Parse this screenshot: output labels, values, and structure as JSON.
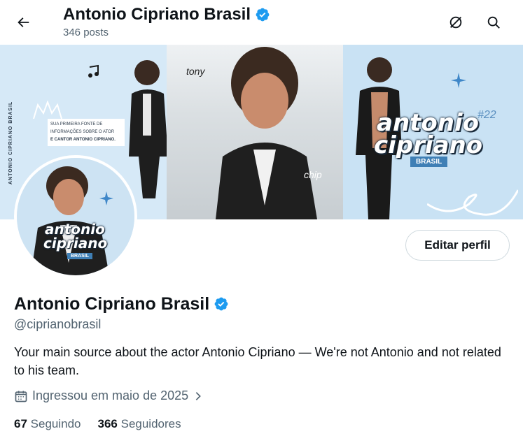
{
  "header": {
    "title": "Antonio Cipriano Brasil",
    "post_count": "346 posts"
  },
  "banner": {
    "tagline_1": "SUA PRIMEIRA FONTE DE",
    "tagline_2": "INFORMAÇÕES SOBRE O ATOR",
    "tagline_3": "E CANTOR ANTONIO CIPRIANO.",
    "vertical_text": "ANTONIO CIPRIANO BRASIL",
    "logo_line1": "antonio",
    "logo_line2": "cipriano",
    "logo_badge": "BRASIL",
    "hashtag": "#22",
    "scribble_1": "tony",
    "scribble_2": "chip"
  },
  "profile": {
    "name": "Antonio Cipriano Brasil",
    "handle": "@ciprianobrasil",
    "bio": "Your main source about the actor Antonio Cipriano — We're not Antonio and not related to his team.",
    "joined": "Ingressou em maio de 2025",
    "following_count": "67",
    "following_label": "Seguindo",
    "followers_count": "366",
    "followers_label": "Seguidores",
    "edit_label": "Editar perfil"
  },
  "colors": {
    "verified": "#1d9bf0",
    "banner_bg": "#c9e2f4",
    "muted_text": "#536471"
  }
}
